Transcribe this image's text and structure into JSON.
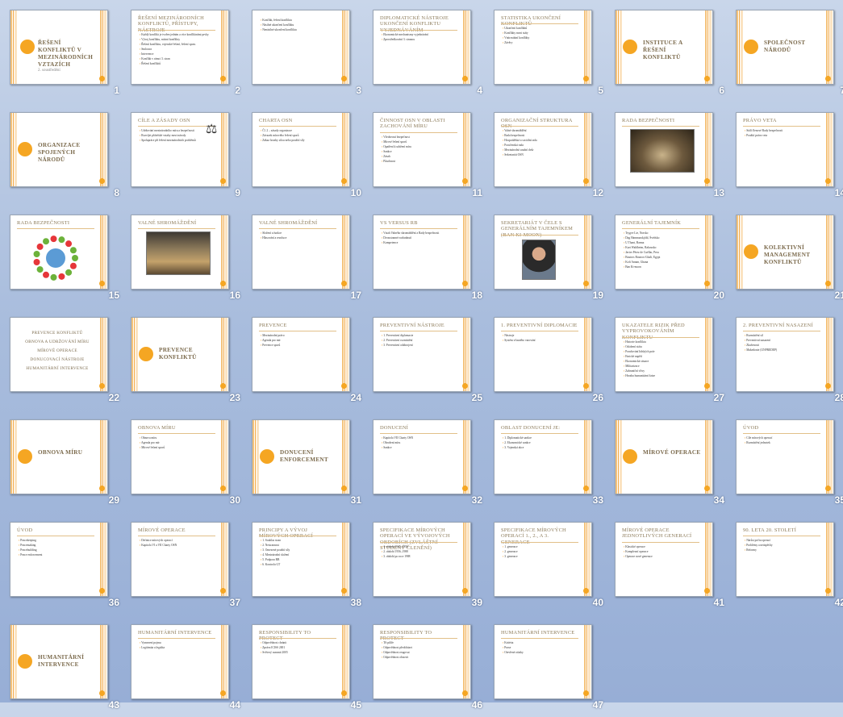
{
  "slides": [
    {
      "n": "1",
      "layout": "title",
      "title": "ŘEŠENÍ KONFLIKTŮ V MEZINÁRODNÍCH VZTAZÍCH",
      "subtitle": "2. soustředění"
    },
    {
      "n": "2",
      "layout": "content",
      "title": "ŘEŠENÍ MEZINÁRODNÍCH KONFLIKTŮ, PŘÍSTUPY, NÁSTROJE",
      "bullets": [
        "Každý konflikt je tvořen jedním a více konfliktními prvky",
        "Vývoj konfliktu, místní konflikty",
        "Řešení konfliktu, vojenské řešení, řešení sporu",
        "Smlouva",
        "Intervence",
        "Konflikt v rámci 3. stran",
        "Řešení konfliktů"
      ]
    },
    {
      "n": "3",
      "layout": "content",
      "title": "",
      "bullets": [
        "Konflikt, řešení konfliktu",
        "Násilné ukončení konfliktu",
        "Nenásilné ukončení konfliktu"
      ]
    },
    {
      "n": "4",
      "layout": "content",
      "title": "DIPLOMATICKÉ NÁSTROJE UKONČENÍ KONFLIKTU VYJEDNÁVÁNÍM",
      "bullets": [
        "Ekonomické mechanismy vyjednávání",
        "Zprostředkování 3. stranou"
      ]
    },
    {
      "n": "5",
      "layout": "content",
      "title": "STATISTIKA UKONČENÍ KONFLIKTŮ",
      "bullets": [
        "Ukončení konfliktů",
        "Konflikty mezi státy",
        "Vnitrostátní konflikty",
        "Závěry"
      ]
    },
    {
      "n": "6",
      "layout": "section",
      "title": "INSTITUCE A ŘEŠENÍ KONFLIKTŮ"
    },
    {
      "n": "7",
      "layout": "section",
      "title": "SPOLEČNOST NÁRODŮ"
    },
    {
      "n": "8",
      "layout": "section",
      "title": "ORGANIZACE SPOJENÝCH NÁRODŮ"
    },
    {
      "n": "9",
      "layout": "content",
      "title": "CÍLE A ZÁSADY OSN",
      "bullets": [
        "Udržování mezinárodního míru a bezpečnosti",
        "Rozvíjet přátelské vztahy mezi národy",
        "Spolupráce při řešení mezinárodních problémů"
      ]
    },
    {
      "n": "10",
      "layout": "content",
      "title": "CHARTA OSN",
      "bullets": [
        "Čl. 2 – zásady organizace",
        "Závazek mírového řešení sporů",
        "Zákaz hrozby silou nebo použití síly"
      ]
    },
    {
      "n": "11",
      "layout": "content",
      "title": "ČINNOST OSN V OBLASTI ZACHOVÁNÍ MÍRU",
      "bullets": [
        "Všeobecná bezpečnost",
        "Mírové řešení sporů",
        "Opatření k udržení míru",
        "Sankce",
        "Zásah",
        "Působnost"
      ]
    },
    {
      "n": "12",
      "layout": "content",
      "title": "ORGANIZAČNÍ STRUKTURA OSN",
      "bullets": [
        "Valné shromáždění",
        "Rada bezpečnosti",
        "Hospodářská a sociální rada",
        "Poručenská rada",
        "Mezinárodní soudní dvůr",
        "Sekretariát OSN"
      ]
    },
    {
      "n": "13",
      "layout": "photo",
      "title": "RADA BEZPEČNOSTI"
    },
    {
      "n": "14",
      "layout": "content",
      "title": "PRÁVO VETA",
      "bullets": [
        "Stálí členové Rady bezpečnosti",
        "Použití práva veta"
      ]
    },
    {
      "n": "15",
      "layout": "diagram",
      "title": "RADA BEZPEČNOSTI"
    },
    {
      "n": "16",
      "layout": "photo",
      "title": "VALNÉ SHROMÁŽDĚNÍ"
    },
    {
      "n": "17",
      "layout": "content",
      "title": "VALNÉ SHROMÁŽDĚNÍ",
      "bullets": [
        "Složení a funkce",
        "Hlasování a rezoluce"
      ]
    },
    {
      "n": "18",
      "layout": "content",
      "title": "VS VERSUS RB",
      "bullets": [
        "Vztah Valného shromáždění a Rady bezpečnosti",
        "Dvoustranné rozhodnutí",
        "Kompetence"
      ]
    },
    {
      "n": "19",
      "layout": "portrait",
      "title": "SEKRETARIÁT V ČELE S GENERÁLNÍM TAJEMNÍKEM (BAN KI-MOON)"
    },
    {
      "n": "20",
      "layout": "content",
      "title": "GENERÁLNÍ TAJEMNÍK",
      "bullets": [
        "Trygve Lie, Norsko",
        "Dag Hammarskjöld, Švédsko",
        "U Thant, Barma",
        "Kurt Waldheim, Rakousko",
        "Javier Pérez de Cuéllar, Peru",
        "Boutros Boutros-Ghali, Egypt",
        "Kofi Annan, Ghana",
        "Ban Ki-moon"
      ]
    },
    {
      "n": "21",
      "layout": "section",
      "title": "KOLEKTIVNÍ MANAGEMENT KONFLIKTŮ"
    },
    {
      "n": "22",
      "layout": "list",
      "title": "",
      "bullets": [
        "PREVENCE KONFLIKTŮ",
        "OBNOVA A UDRŽOVÁNÍ MÍRU",
        "MÍROVÉ OPERACE",
        "DONUCOVACÍ NÁSTROJE",
        "HUMANITÁRNÍ INTERVENCE"
      ]
    },
    {
      "n": "23",
      "layout": "section",
      "title": "PREVENCE KONFLIKTŮ"
    },
    {
      "n": "24",
      "layout": "content",
      "title": "PREVENCE",
      "bullets": [
        "Mezinárodní právo",
        "Agenda pro mír",
        "Prevence sporů"
      ]
    },
    {
      "n": "25",
      "layout": "content",
      "title": "PREVENTIVNÍ NÁSTROJE",
      "bullets": [
        "1. Preventivní diplomacie",
        "2. Preventivní rozmístění",
        "3. Preventivní odzbrojení"
      ]
    },
    {
      "n": "26",
      "layout": "content",
      "title": "1. PREVENTIVNÍ DIPLOMACIE",
      "bullets": [
        "Nástroje",
        "Systém včasného varování"
      ]
    },
    {
      "n": "27",
      "layout": "content",
      "title": "UKAZATELE RIZIK PŘED VYPROVOKOVÁNÍM KONFLIKTU",
      "bullets": [
        "Historie konfliktu",
        "Oslabení státu",
        "Porušování lidských práv",
        "Etnické napětí",
        "Ekonomická situace",
        "Militarizace",
        "Zahraniční vlivy",
        "Hrozba humanitární krize"
      ]
    },
    {
      "n": "28",
      "layout": "content",
      "title": "2. PREVENTIVNÍ NASAZENÍ",
      "bullets": [
        "Rozmístění sil",
        "Preventivní nasazení",
        "Zkušenosti",
        "Makedonie (UNPREDEP)"
      ]
    },
    {
      "n": "29",
      "layout": "section",
      "title": "OBNOVA MÍRU"
    },
    {
      "n": "30",
      "layout": "content",
      "title": "OBNOVA MÍRU",
      "bullets": [
        "Obnova míru",
        "Agenda pro mír",
        "Mírové řešení sporů"
      ]
    },
    {
      "n": "31",
      "layout": "section",
      "title": "DONUCENÍ ENFORCEMENT"
    },
    {
      "n": "32",
      "layout": "content",
      "title": "DONUCENÍ",
      "bullets": [
        "Kapitola VII Charty OSN",
        "Ohrožení míru",
        "Sankce"
      ]
    },
    {
      "n": "33",
      "layout": "content",
      "title": "OBLAST DONUCENÍ JE:",
      "bullets": [
        "1. Diplomatické sankce",
        "2. Ekonomické sankce",
        "3. Vojenská akce"
      ]
    },
    {
      "n": "34",
      "layout": "section",
      "title": "MÍROVÉ OPERACE"
    },
    {
      "n": "35",
      "layout": "content",
      "title": "ÚVOD",
      "bullets": [
        "Cíle mírových operací",
        "Rozmístění jednotek"
      ]
    },
    {
      "n": "36",
      "layout": "content",
      "title": "ÚVOD",
      "bullets": [
        "Peacekeeping",
        "Peacemaking",
        "Peacebuilding",
        "Peace enforcement"
      ]
    },
    {
      "n": "37",
      "layout": "content",
      "title": "MÍROVÉ OPERACE",
      "bullets": [
        "Definice mírových operací",
        "Kapitola VI a VII Charty OSN"
      ]
    },
    {
      "n": "38",
      "layout": "content",
      "title": "PRINCIPY A VÝVOJ MÍROVÝCH OPERACÍ",
      "bullets": [
        "1. Souhlas stran",
        "2. Nestrannost",
        "3. Omezené použití síly",
        "4. Mezinárodní složení",
        "5. Podpora RB",
        "6. Kontrola GT"
      ]
    },
    {
      "n": "39",
      "layout": "content",
      "title": "SPECIFIKACE MÍROVÝCH OPERACÍ VE VÝVOJOVÝCH OBDOBÍCH (ZVLÁŠTNÍ STUDENÝ ČLENĚNÍ)",
      "bullets": [
        "1. období 1945–1956",
        "2. období 1956–1988",
        "3. období po roce 1988"
      ]
    },
    {
      "n": "40",
      "layout": "content",
      "title": "SPECIFIKACE MÍROVÝCH OPERACÍ 1., 2., A 3. GENERACE",
      "bullets": [
        "1. generace",
        "2. generace",
        "3. generace"
      ]
    },
    {
      "n": "41",
      "layout": "content",
      "title": "MÍROVÉ OPERACE JEDNOTLIVÝCH GENERACÍ",
      "bullets": [
        "Klasické operace",
        "Komplexní operace",
        "Operace nové generace"
      ]
    },
    {
      "n": "42",
      "layout": "content",
      "title": "90. LETA 20. STOLETÍ",
      "bullets": [
        "Nárůst počtu operací",
        "Problémy a neúspěchy",
        "Reformy"
      ]
    },
    {
      "n": "43",
      "layout": "section",
      "title": "HUMANITÁRNÍ INTERVENCE"
    },
    {
      "n": "44",
      "layout": "content",
      "title": "HUMANITÁRNÍ INTERVENCE",
      "bullets": [
        "Vymezení pojmu",
        "Legitimita a legalita"
      ]
    },
    {
      "n": "45",
      "layout": "content",
      "title": "RESPONSIBILITY TO PROTECT",
      "bullets": [
        "Odpovědnost chránit",
        "Zpráva ICISS 2001",
        "Světový summit 2005"
      ]
    },
    {
      "n": "46",
      "layout": "content",
      "title": "RESPONSIBILITY TO PROTECT",
      "bullets": [
        "Tři pilíře",
        "Odpovědnost předcházet",
        "Odpovědnost reagovat",
        "Odpovědnost obnovit"
      ]
    },
    {
      "n": "47",
      "layout": "content",
      "title": "HUMANITÁRNÍ INTERVENCE",
      "bullets": [
        "Kritéria",
        "Praxe",
        "Otevřené otázky"
      ]
    }
  ]
}
